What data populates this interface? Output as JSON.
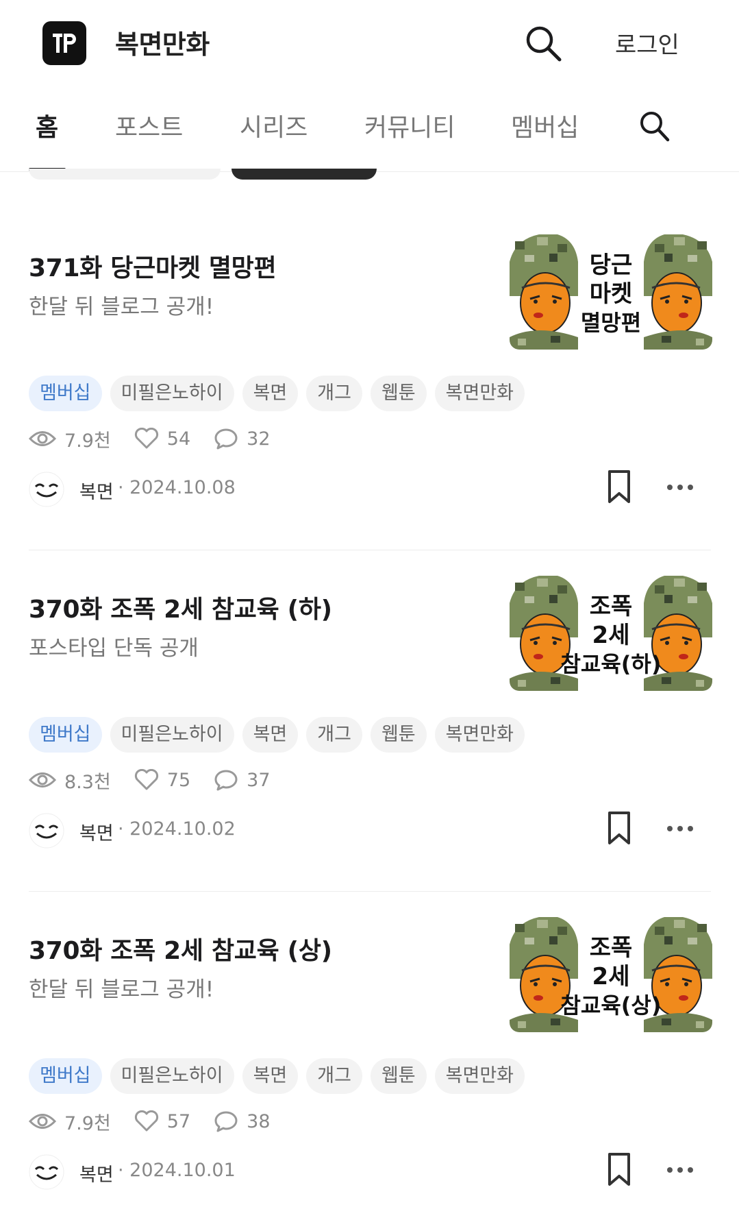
{
  "header": {
    "site_title": "복면만화",
    "login_label": "로그인",
    "logo_icon": "tp-logo-icon",
    "search_icon": "search-icon"
  },
  "tabs": [
    {
      "label": "홈",
      "active": true
    },
    {
      "label": "포스트",
      "active": false
    },
    {
      "label": "시리즈",
      "active": false
    },
    {
      "label": "커뮤니티",
      "active": false
    },
    {
      "label": "멤버십",
      "active": false
    }
  ],
  "colors": {
    "member_tag_bg": "#e9f1fd",
    "member_tag_text": "#3f79c9",
    "tag_bg": "#f3f3f3"
  },
  "posts": [
    {
      "title": "371화 당근마켓 멸망편",
      "subtitle": "한달 뒤 블로그 공개!",
      "thumb_text": [
        "당근",
        "마켓",
        "멸망편"
      ],
      "tags": [
        "멤버십",
        "미필은노하이",
        "복면",
        "개그",
        "웹툰",
        "복면만화"
      ],
      "views": "7.9천",
      "likes": "54",
      "comments": "32",
      "author": "복면",
      "date": "· 2024.10.08"
    },
    {
      "title": "370화 조폭 2세 참교육 (하)",
      "subtitle": "포스타입 단독 공개",
      "thumb_text": [
        "조폭",
        "2세",
        "참교육(하)"
      ],
      "tags": [
        "멤버십",
        "미필은노하이",
        "복면",
        "개그",
        "웹툰",
        "복면만화"
      ],
      "views": "8.3천",
      "likes": "75",
      "comments": "37",
      "author": "복면",
      "date": "· 2024.10.02"
    },
    {
      "title": "370화 조폭 2세 참교육 (상)",
      "subtitle": "한달 뒤 블로그 공개!",
      "thumb_text": [
        "조폭",
        "2세",
        "참교육(상)"
      ],
      "tags": [
        "멤버십",
        "미필은노하이",
        "복면",
        "개그",
        "웹툰",
        "복면만화"
      ],
      "views": "7.9천",
      "likes": "57",
      "comments": "38",
      "author": "복면",
      "date": "· 2024.10.01"
    }
  ]
}
